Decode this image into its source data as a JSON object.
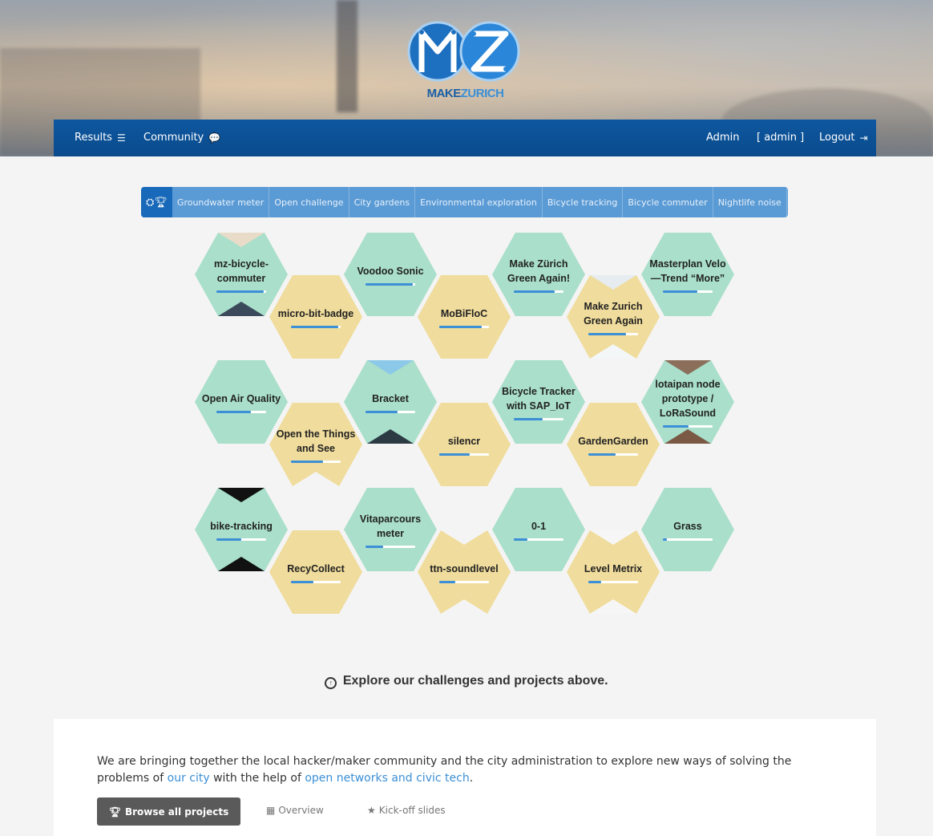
{
  "brand": {
    "logo_make": "MAKE",
    "logo_zurich": "ZURICH"
  },
  "navbar": {
    "results_label": "Results",
    "community_label": "Community",
    "admin_label": "Admin",
    "user_label": "[ admin ]",
    "logout_label": "Logout"
  },
  "challenge_tabs": {
    "icons": [
      "cubes-icon",
      "trophy-icon"
    ],
    "items": [
      "Groundwater meter",
      "Open challenge",
      "City gardens",
      "Environmental exploration",
      "Bicycle tracking",
      "Bicycle commuter",
      "Nightlife noise"
    ],
    "menu_icon": "bars-icon"
  },
  "projects": [
    {
      "title": "mz-bicycle-commuter",
      "progress": 0.95,
      "color": "teal"
    },
    {
      "title": "micro-bit-badge",
      "progress": 0.95,
      "color": "yellow"
    },
    {
      "title": "Voodoo Sonic",
      "progress": 0.95,
      "color": "teal"
    },
    {
      "title": "MoBiFloC",
      "progress": 0.85,
      "color": "yellow"
    },
    {
      "title": "Make Zürich Green Again!",
      "progress": 0.82,
      "color": "teal"
    },
    {
      "title": "Make Zurich Green Again",
      "progress": 0.75,
      "color": "yellow"
    },
    {
      "title": "Masterplan Velo—Trend “More”",
      "progress": 0.7,
      "color": "teal"
    },
    {
      "title": "Open Air Quality",
      "progress": 0.7,
      "color": "teal"
    },
    {
      "title": "Open the Things and See",
      "progress": 0.65,
      "color": "yellow"
    },
    {
      "title": "Bracket",
      "progress": 0.65,
      "color": "teal"
    },
    {
      "title": "silencr",
      "progress": 0.62,
      "color": "yellow"
    },
    {
      "title": "Bicycle Tracker with SAP_IoT",
      "progress": 0.58,
      "color": "teal"
    },
    {
      "title": "GardenGarden",
      "progress": 0.55,
      "color": "yellow"
    },
    {
      "title": "lotaipan node prototype / LoRaSound",
      "progress": 0.52,
      "color": "teal"
    },
    {
      "title": "bike-tracking",
      "progress": 0.5,
      "color": "teal"
    },
    {
      "title": "RecyCollect",
      "progress": 0.45,
      "color": "yellow"
    },
    {
      "title": "Vitaparcours meter",
      "progress": 0.35,
      "color": "teal"
    },
    {
      "title": "ttn-soundlevel",
      "progress": 0.32,
      "color": "yellow"
    },
    {
      "title": "0-1",
      "progress": 0.28,
      "color": "teal"
    },
    {
      "title": "Level Metrix",
      "progress": 0.25,
      "color": "yellow"
    },
    {
      "title": "Grass",
      "progress": 0.08,
      "color": "teal"
    }
  ],
  "explore_text": "Explore our challenges and projects above.",
  "intro": {
    "part1": "We are bringing together the local hacker/maker community and the city administration to explore new ways of solving the problems of ",
    "link1": "our city",
    "part2": " with the help of ",
    "link2": "open networks and civic tech",
    "part3": "."
  },
  "actions": {
    "browse_label": "Browse all projects",
    "overview_label": "Overview",
    "kickoff_label": "Kick-off slides"
  }
}
